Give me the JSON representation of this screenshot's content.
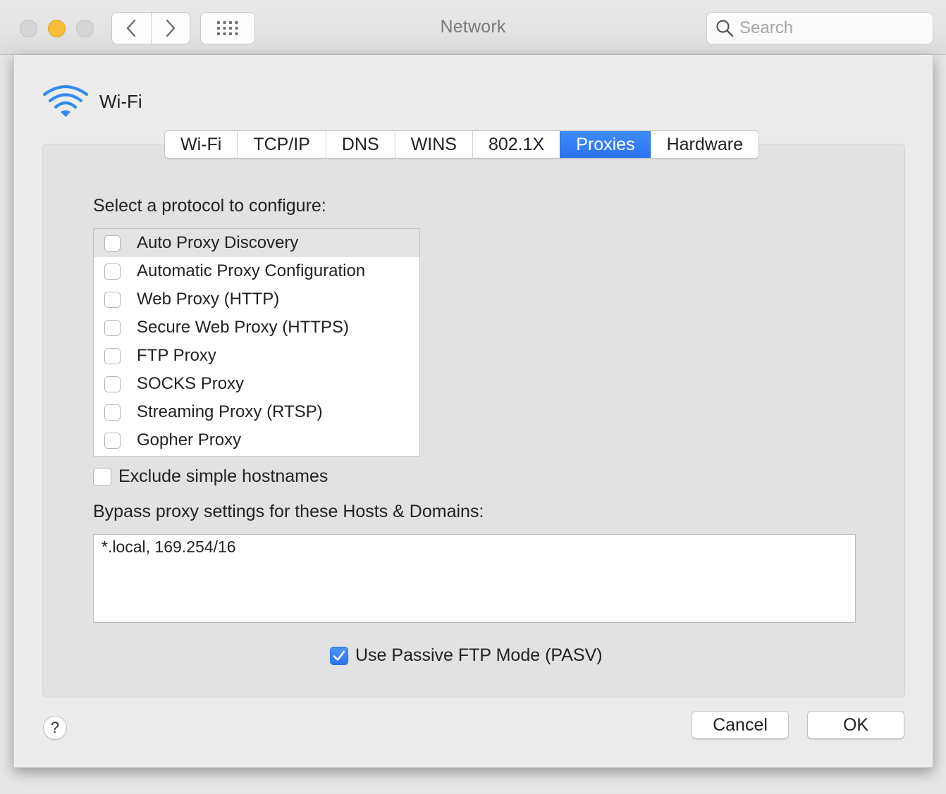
{
  "window": {
    "title": "Network",
    "traffic_lights": [
      "close",
      "minimize",
      "zoom"
    ],
    "nav": {
      "back_icon": "chevron-left-icon",
      "forward_icon": "chevron-right-icon",
      "grid_icon": "grid-icon"
    },
    "search": {
      "placeholder": "Search",
      "value": ""
    }
  },
  "interface": {
    "name": "Wi-Fi",
    "icon": "wifi-icon"
  },
  "tabs": [
    {
      "label": "Wi-Fi",
      "active": false
    },
    {
      "label": "TCP/IP",
      "active": false
    },
    {
      "label": "DNS",
      "active": false
    },
    {
      "label": "WINS",
      "active": false
    },
    {
      "label": "802.1X",
      "active": false
    },
    {
      "label": "Proxies",
      "active": true
    },
    {
      "label": "Hardware",
      "active": false
    }
  ],
  "proxies": {
    "select_label": "Select a protocol to configure:",
    "protocols": [
      {
        "label": "Auto Proxy Discovery",
        "checked": false,
        "selected": true
      },
      {
        "label": "Automatic Proxy Configuration",
        "checked": false,
        "selected": false
      },
      {
        "label": "Web Proxy (HTTP)",
        "checked": false,
        "selected": false
      },
      {
        "label": "Secure Web Proxy (HTTPS)",
        "checked": false,
        "selected": false
      },
      {
        "label": "FTP Proxy",
        "checked": false,
        "selected": false
      },
      {
        "label": "SOCKS Proxy",
        "checked": false,
        "selected": false
      },
      {
        "label": "Streaming Proxy (RTSP)",
        "checked": false,
        "selected": false
      },
      {
        "label": "Gopher Proxy",
        "checked": false,
        "selected": false
      }
    ],
    "exclude_simple": {
      "label": "Exclude simple hostnames",
      "checked": false
    },
    "bypass_label": "Bypass proxy settings for these Hosts & Domains:",
    "bypass_value": "*.local, 169.254/16",
    "pasv": {
      "label": "Use Passive FTP Mode (PASV)",
      "checked": true
    }
  },
  "footer": {
    "help_label": "?",
    "cancel_label": "Cancel",
    "ok_label": "OK"
  },
  "colors": {
    "accent": "#2b72f0",
    "minimize": "#f6be36"
  }
}
